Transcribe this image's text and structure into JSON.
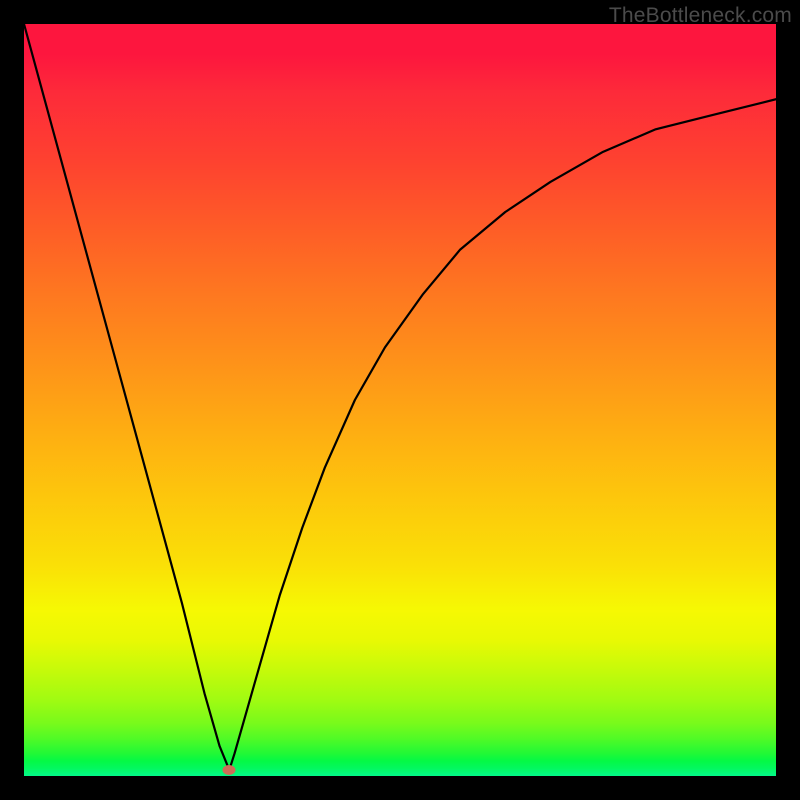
{
  "watermark": "TheBottleneck.com",
  "marker": {
    "x_pct": 27.3,
    "y_pct": 99.2
  },
  "chart_data": {
    "type": "line",
    "title": "",
    "xlabel": "",
    "ylabel": "",
    "xlim": [
      0,
      100
    ],
    "ylim": [
      0,
      100
    ],
    "grid": false,
    "legend": false,
    "annotations": [
      "TheBottleneck.com"
    ],
    "gradient_stops": [
      {
        "pct": 0,
        "color": "#fd163e"
      },
      {
        "pct": 20,
        "color": "#fe4432"
      },
      {
        "pct": 40,
        "color": "#fe851c"
      },
      {
        "pct": 60,
        "color": "#fdc20d"
      },
      {
        "pct": 78,
        "color": "#f6f903"
      },
      {
        "pct": 90,
        "color": "#9ffb12"
      },
      {
        "pct": 100,
        "color": "#03f889"
      }
    ],
    "marker_point": {
      "x": 27.3,
      "y": 0.8
    },
    "series": [
      {
        "name": "curve",
        "x": [
          0,
          3,
          6,
          9,
          12,
          15,
          18,
          21,
          24,
          26,
          27.3,
          28,
          30,
          32,
          34,
          37,
          40,
          44,
          48,
          53,
          58,
          64,
          70,
          77,
          84,
          92,
          100
        ],
        "y": [
          100,
          89,
          78,
          67,
          56,
          45,
          34,
          23,
          11,
          4,
          0.8,
          3,
          10,
          17,
          24,
          33,
          41,
          50,
          57,
          64,
          70,
          75,
          79,
          83,
          86,
          88,
          90
        ]
      }
    ]
  }
}
